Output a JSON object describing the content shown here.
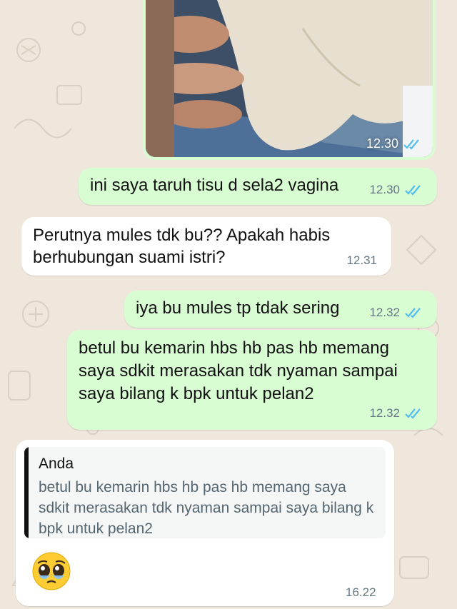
{
  "chat": {
    "media_time": "12.30",
    "messages": [
      {
        "id": "m1",
        "dir": "out",
        "text": "ini saya taruh tisu d sela2 vagina",
        "time": "12.30",
        "status": "read"
      },
      {
        "id": "m2",
        "dir": "in",
        "text": "Perutnya mules tdk bu?? Apakah habis berhubungan suami istri?",
        "time": "12.31"
      },
      {
        "id": "m3",
        "dir": "out",
        "text": "iya bu mules tp tdak sering",
        "time": "12.32",
        "status": "read"
      },
      {
        "id": "m4",
        "dir": "out",
        "text": "betul bu kemarin hbs hb pas hb memang saya sdkit merasakan tdk nyaman sampai saya bilang k bpk untuk pelan2",
        "time": "12.32",
        "status": "read"
      },
      {
        "id": "m5",
        "dir": "in",
        "time": "16.22",
        "emoji": "pleading-face",
        "reply": {
          "author": "Anda",
          "text": "betul bu kemarin hbs hb pas hb memang saya sdkit merasakan tdk nyaman sampai saya bilang k bpk untuk pelan2"
        }
      }
    ]
  },
  "colors": {
    "outgoing": "#d9fdd3",
    "incoming": "#ffffff",
    "read_ticks": "#53bdeb",
    "wallpaper": "#efe7dc"
  }
}
